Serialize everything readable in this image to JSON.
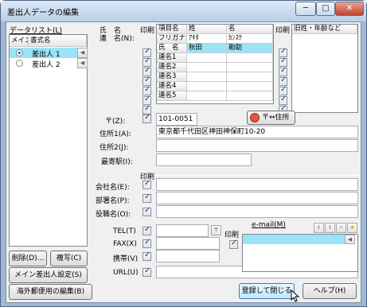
{
  "window": {
    "title": "差出人データの編集",
    "minimize": "─",
    "maximize": "□",
    "close": "✕"
  },
  "datalist": {
    "label": "データリスト(L)",
    "col_main": "メイン",
    "col_name": "書式名",
    "rows": [
      {
        "name": "差出人 1",
        "selected": true
      },
      {
        "name": "差出人 2",
        "selected": false
      }
    ],
    "scroll_left": "◀",
    "scroll_right": "◀"
  },
  "buttons": {
    "delete": "削除(D)...",
    "copy": "複写(C)",
    "main_setting": "メイン差出人設定(S)",
    "overseas": "海外郵便用の編集(B)",
    "save_close": "登録して閉じる",
    "help": "ヘルプ(H)",
    "zip_to_address": "〒⇔住所"
  },
  "name_section": {
    "label": "氏　名\n連　名(N):",
    "label_line1": "氏　名",
    "label_line2": "連　名(N):",
    "print_label": "印刷",
    "grid_headers": [
      "項目名",
      "姓",
      "名"
    ],
    "grid_rows": [
      [
        "フリガナ",
        "ｱｷﾀ",
        "ｶﾝｽｹ"
      ],
      [
        "氏　名",
        "秋田",
        "勘助"
      ],
      [
        "連名1",
        "",
        ""
      ],
      [
        "連名2",
        "",
        ""
      ],
      [
        "連名3",
        "",
        ""
      ],
      [
        "連名4",
        "",
        ""
      ],
      [
        "連名5",
        "",
        ""
      ]
    ],
    "old_name_print": "印刷",
    "old_name_header": "旧姓・年齢など"
  },
  "address": {
    "zip_label": "〒(Z):",
    "zip_value": "101-0051",
    "addr1_label": "住所1(A):",
    "addr1_value": "東京都千代田区神田神保町10-20",
    "addr2_label": "住所2(J):",
    "addr2_value": "",
    "station_label": "最寄駅(I):",
    "station_value": ""
  },
  "company": {
    "print_label": "印刷",
    "company_label": "会社名(E):",
    "dept_label": "部署名(P):",
    "title_label": "役職名(O):"
  },
  "contact": {
    "tel_label": "TEL(T)",
    "fax_label": "FAX(X)",
    "mobile_label": "携帯(V)",
    "url_label": "URL(U)",
    "tel_icon": "〒",
    "print_label": "印刷",
    "email_label": "e-mail(M)"
  }
}
